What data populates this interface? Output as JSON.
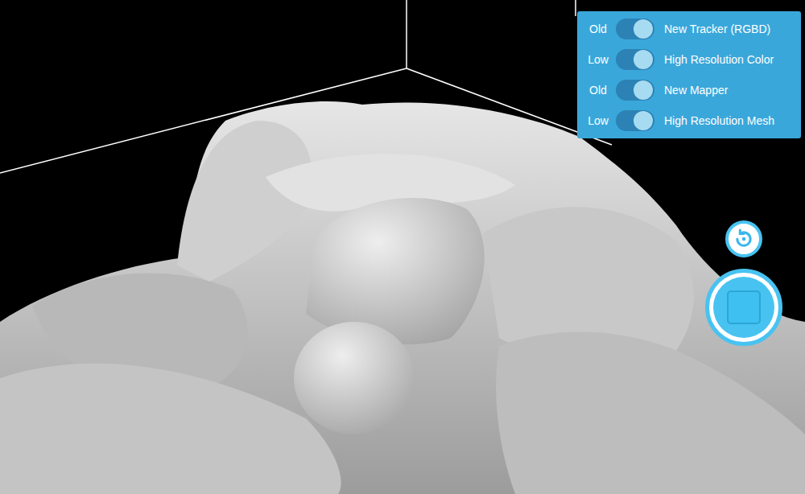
{
  "settings": [
    {
      "left": "Old",
      "right": "New Tracker (RGBD)",
      "on": true
    },
    {
      "left": "Low",
      "right": "High Resolution Color",
      "on": true
    },
    {
      "left": "Old",
      "right": "New Mapper",
      "on": true
    },
    {
      "left": "Low",
      "right": "High Resolution Mesh",
      "on": true
    }
  ],
  "recording": true
}
